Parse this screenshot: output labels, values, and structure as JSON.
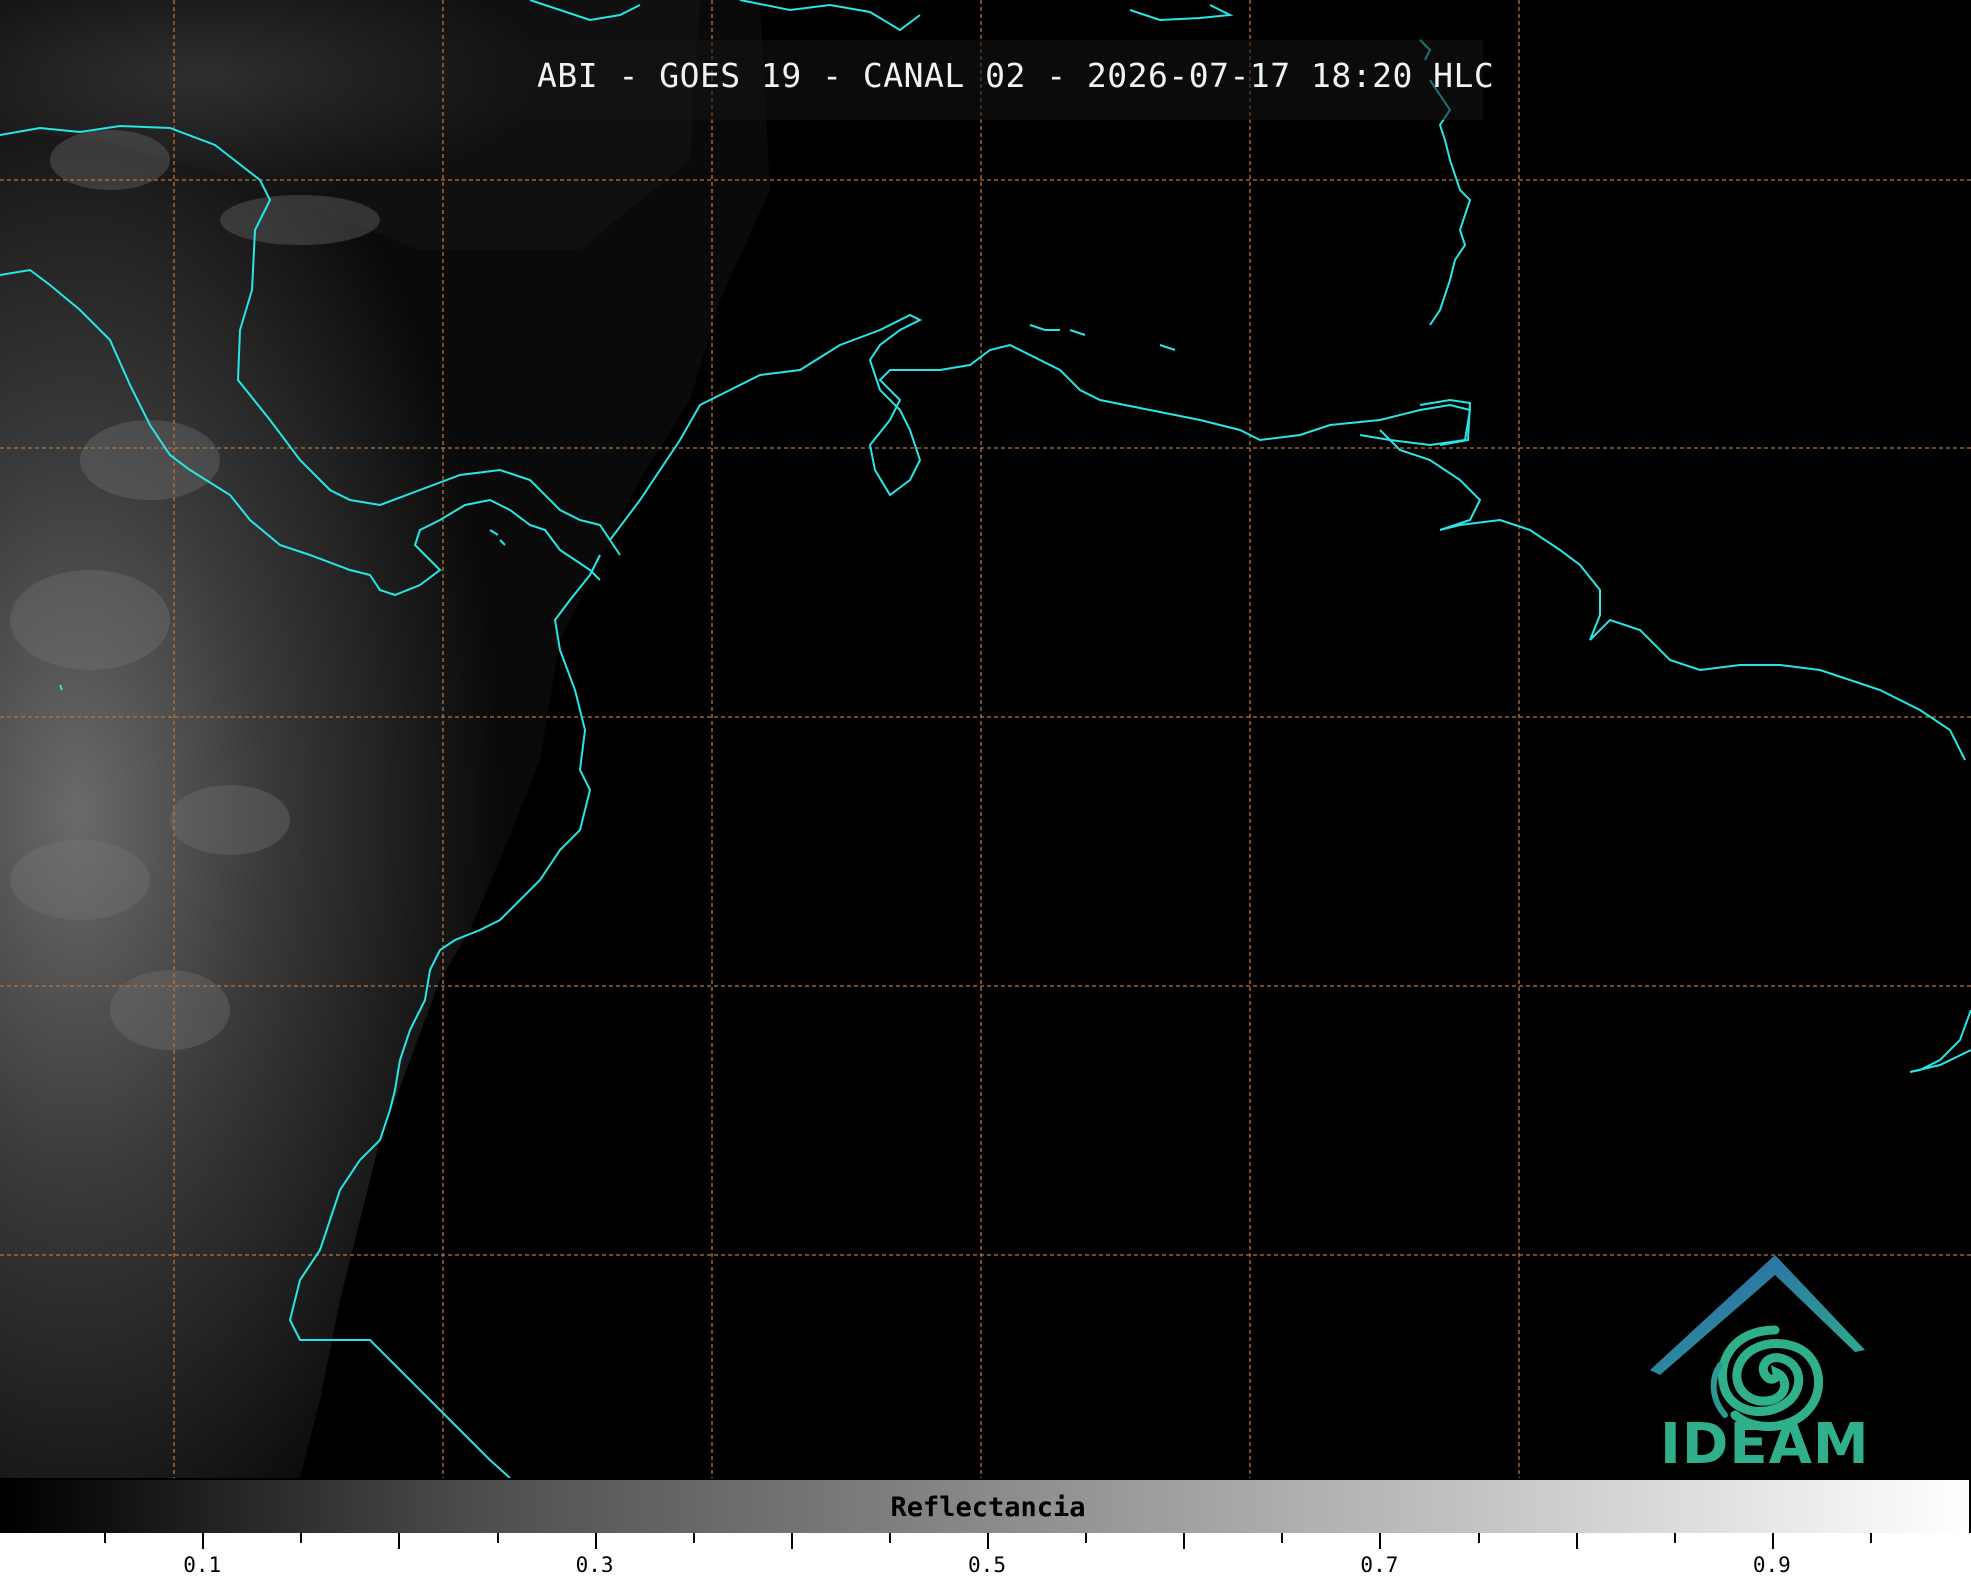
{
  "title": "ABI - GOES 19 - CANAL 02 - 2026-07-17 18:20 HLC",
  "logo": {
    "text": "IDEAM"
  },
  "colorbar": {
    "label": "Reflectancia",
    "range": [
      0.0,
      1.0
    ],
    "tick_labels": [
      "0.1",
      "0.3",
      "0.5",
      "0.7",
      "0.9"
    ]
  },
  "colors": {
    "coastline": "#27e6e6",
    "gridline": "#b8733a",
    "logo_blue": "#2a5db0",
    "logo_green": "#2fb08a"
  }
}
